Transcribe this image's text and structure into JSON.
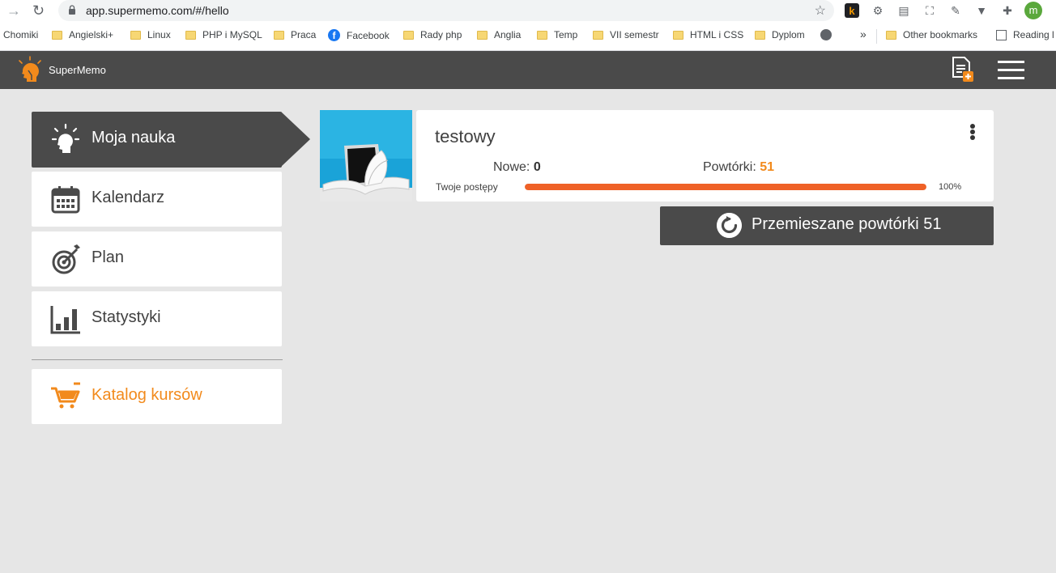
{
  "browser": {
    "url": "app.supermemo.com/#/hello",
    "bookmarks": [
      {
        "label": "Chomiki",
        "icon": "none"
      },
      {
        "label": "Angielski+",
        "icon": "folder-icon"
      },
      {
        "label": "Linux",
        "icon": "folder-icon"
      },
      {
        "label": "PHP i MySQL",
        "icon": "folder-icon"
      },
      {
        "label": "Praca",
        "icon": "folder-icon"
      },
      {
        "label": "Facebook",
        "icon": "facebook-icon"
      },
      {
        "label": "Rady php",
        "icon": "folder-icon"
      },
      {
        "label": "Anglia",
        "icon": "folder-icon"
      },
      {
        "label": "Temp",
        "icon": "folder-icon"
      },
      {
        "label": "VII semestr",
        "icon": "folder-icon"
      },
      {
        "label": "HTML i CSS",
        "icon": "folder-icon"
      },
      {
        "label": "Dyplom",
        "icon": "folder-icon"
      }
    ],
    "overflow_label": "»",
    "other_bookmarks": "Other bookmarks",
    "reading_list": "Reading l",
    "avatar_letter": "m"
  },
  "app": {
    "logo_text": "SuperMemo",
    "accent_color": "#f28a1c",
    "header_color": "#4a4a4a"
  },
  "sidebar": {
    "items": [
      {
        "label": "Moja nauka",
        "icon": "bulb-head-icon",
        "active": true
      },
      {
        "label": "Kalendarz",
        "icon": "calendar-icon",
        "active": false
      },
      {
        "label": "Plan",
        "icon": "target-icon",
        "active": false
      },
      {
        "label": "Statystyki",
        "icon": "bar-chart-icon",
        "active": false
      }
    ],
    "catalog": {
      "label": "Katalog kursów",
      "icon": "cart-icon"
    }
  },
  "course": {
    "title": "testowy",
    "new_label": "Nowe:",
    "new_value": "0",
    "reviews_label": "Powtórki:",
    "reviews_value": "51",
    "progress_label": "Twoje postępy",
    "progress_value": "100%",
    "progress_fraction": 1.0
  },
  "mix_button": {
    "label": "Przemieszane powtórki 51",
    "icon": "refresh-icon"
  }
}
